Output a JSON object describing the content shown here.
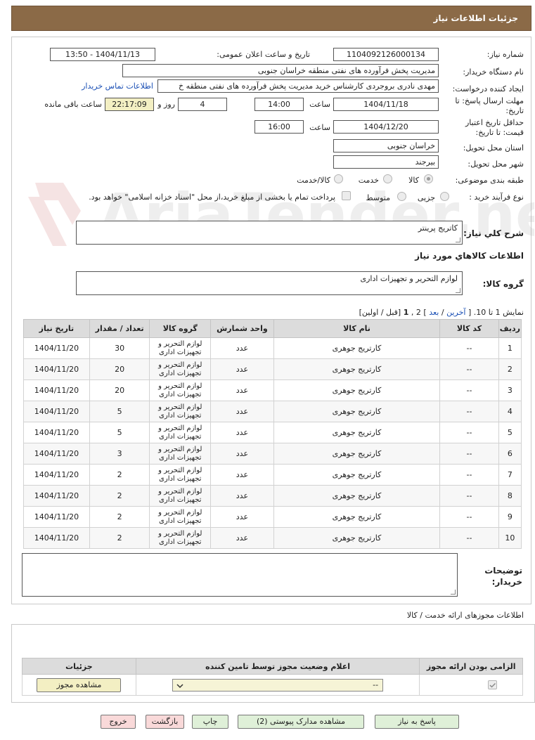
{
  "header": {
    "title": "جزئیات اطلاعات نیاز"
  },
  "form": {
    "need_number_label": "شماره نیاز:",
    "need_number": "1104092126000134",
    "announce_label": "تاریخ و ساعت اعلان عمومی:",
    "announce_value": "1404/11/13 - 13:50",
    "buyer_label": "نام دستگاه خریدار:",
    "buyer_value": "مدیریت پخش فرآورده های نفتی منطقه خراسان جنوبی",
    "creator_label": "ایجاد کننده درخواست:",
    "creator_value": "مهدی نادری بروجردی کارشناس خرید مدیریت پخش فرآورده های نفتی منطقه خ",
    "contact_link": "اطلاعات تماس خریدار",
    "deadline_label_1": "مهلت ارسال پاسخ: تا",
    "deadline_label_2": "تاریخ:",
    "deadline_date": "1404/11/18",
    "time_label": "ساعت",
    "deadline_time": "14:00",
    "days_value": "4",
    "days_label": "روز و",
    "remaining_time": "22:17:09",
    "remaining_label": "ساعت باقی مانده",
    "validity_label_1": "حداقل تاریخ اعتبار",
    "validity_label_2": "قیمت: تا تاریخ:",
    "validity_date": "1404/12/20",
    "validity_time_label": "ساعت",
    "validity_time": "16:00",
    "province_label": "استان محل تحویل:",
    "province_value": "خراسان جنوبی",
    "city_label": "شهر محل تحویل:",
    "city_value": "بیرجند",
    "category_label": "طبقه بندی موضوعی:",
    "category_options": [
      "کالا",
      "خدمت",
      "کالا/خدمت"
    ],
    "process_label": "نوع فرآیند خرید :",
    "process_options": [
      "جزیی",
      "متوسط"
    ],
    "treasury_note": "پرداخت تمام یا بخشی از مبلغ خرید،از محل \"اسناد خزانه اسلامی\" خواهد بود.",
    "summary_label": "شرح كلي نياز:",
    "summary_value": "کاتریج پرینتر",
    "goods_info_label": "اطلاعات كالاهاي مورد نياز",
    "goods_group_label": "گروه کالا:",
    "goods_group_value": "لوازم التحریر و تجهیزات اداری",
    "paging_text": "نمایش 1 تا 10. [",
    "paging_last": "آخرین",
    "paging_sep": "/",
    "paging_next": "بعد",
    "paging_mid": "] 2 ,",
    "paging_current": "1",
    "paging_end": "[قبل / اولین]",
    "buyer_notes_label_1": "توضیحات",
    "buyer_notes_label_2": "خریدار:"
  },
  "goods_table": {
    "headers": [
      "ردیف",
      "کد کالا",
      "نام کالا",
      "واحد شمارش",
      "گروه کالا",
      "تعداد / مقدار",
      "تاریخ نیاز"
    ],
    "group_line1": "لوازم التحریر و",
    "group_line2": "تجهیزات اداری",
    "rows": [
      {
        "idx": "1",
        "code": "--",
        "name": "کارتریج جوهری",
        "unit": "عدد",
        "qty": "30",
        "date": "1404/11/20"
      },
      {
        "idx": "2",
        "code": "--",
        "name": "کارتریج جوهری",
        "unit": "عدد",
        "qty": "20",
        "date": "1404/11/20"
      },
      {
        "idx": "3",
        "code": "--",
        "name": "کارتریج جوهری",
        "unit": "عدد",
        "qty": "20",
        "date": "1404/11/20"
      },
      {
        "idx": "4",
        "code": "--",
        "name": "کارتریج جوهری",
        "unit": "عدد",
        "qty": "5",
        "date": "1404/11/20"
      },
      {
        "idx": "5",
        "code": "--",
        "name": "کارتریج جوهری",
        "unit": "عدد",
        "qty": "5",
        "date": "1404/11/20"
      },
      {
        "idx": "6",
        "code": "--",
        "name": "کارتریج جوهری",
        "unit": "عدد",
        "qty": "3",
        "date": "1404/11/20"
      },
      {
        "idx": "7",
        "code": "--",
        "name": "کارتریج جوهری",
        "unit": "عدد",
        "qty": "2",
        "date": "1404/11/20"
      },
      {
        "idx": "8",
        "code": "--",
        "name": "کارتریج جوهری",
        "unit": "عدد",
        "qty": "2",
        "date": "1404/11/20"
      },
      {
        "idx": "9",
        "code": "--",
        "name": "کارتریج جوهری",
        "unit": "عدد",
        "qty": "2",
        "date": "1404/11/20"
      },
      {
        "idx": "10",
        "code": "--",
        "name": "کارتریج جوهری",
        "unit": "عدد",
        "qty": "2",
        "date": "1404/11/20"
      }
    ]
  },
  "permits": {
    "title": "اطلاعات مجوزهای ارائه خدمت / کالا",
    "headers": [
      "الزامی بودن ارائه مجوز",
      "اعلام وضعیت مجوز توسط تامین کننده",
      "جزئیات"
    ],
    "status_value": "--",
    "view_button": "مشاهده مجوز"
  },
  "footer": {
    "reply": "پاسخ به نیاز",
    "docs": "مشاهده مدارک پیوستی (2)",
    "print": "چاپ",
    "back": "بازگشت",
    "exit": "خروج"
  },
  "watermark": {
    "text": "AriaTender.net"
  },
  "colors": {
    "header": "#8b6a47",
    "button_green": "#dff0d8",
    "button_pink": "#f9d9d9",
    "highlight_yellow": "#f3efc3"
  }
}
